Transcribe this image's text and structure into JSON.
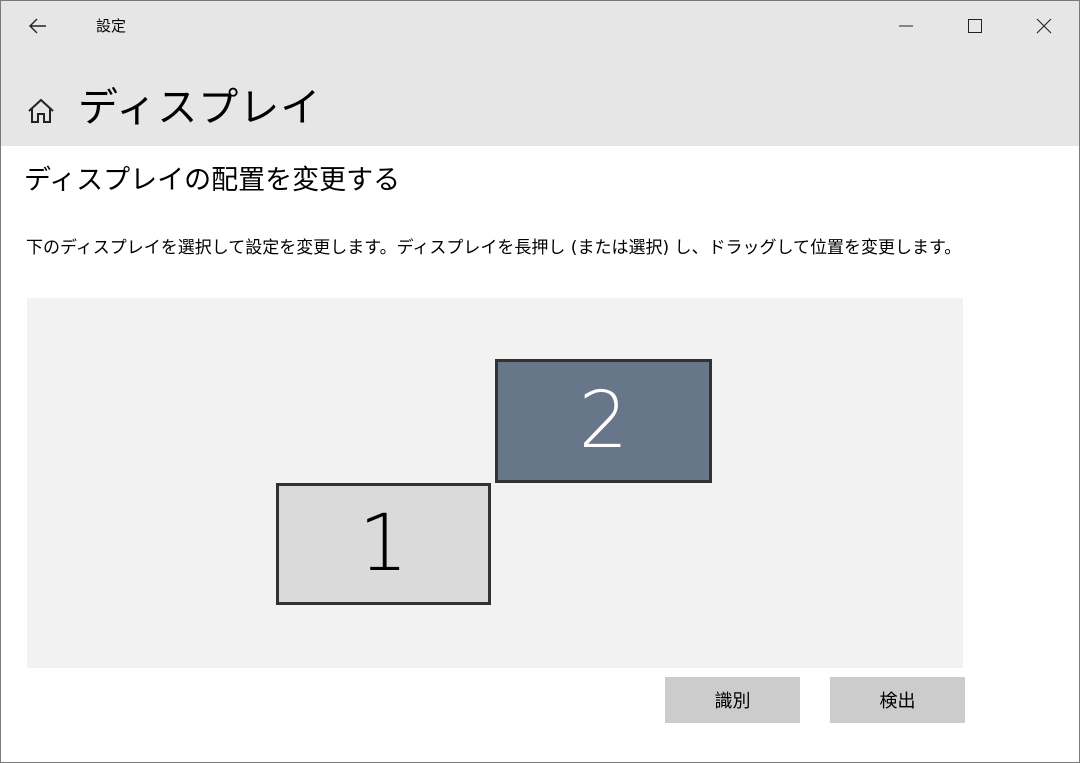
{
  "window": {
    "app_title": "設定",
    "controls": {
      "minimize": "minimize-icon",
      "maximize": "maximize-icon",
      "close": "close-icon"
    }
  },
  "header": {
    "back_icon": "back-arrow-icon",
    "home_icon": "home-icon",
    "page_title": "ディスプレイ"
  },
  "arrangement": {
    "section_title": "ディスプレイの配置を変更する",
    "description": "下のディスプレイを選択して設定を変更します。ディスプレイを長押し (または選択) し、ドラッグして位置を変更します。",
    "monitors": [
      {
        "label": "1",
        "selected": false
      },
      {
        "label": "2",
        "selected": true
      }
    ],
    "colors": {
      "area_bg": "#f2f2f2",
      "monitor_unselected": "#dadada",
      "monitor_selected": "#68768a"
    }
  },
  "buttons": {
    "identify": "識別",
    "detect": "検出"
  }
}
